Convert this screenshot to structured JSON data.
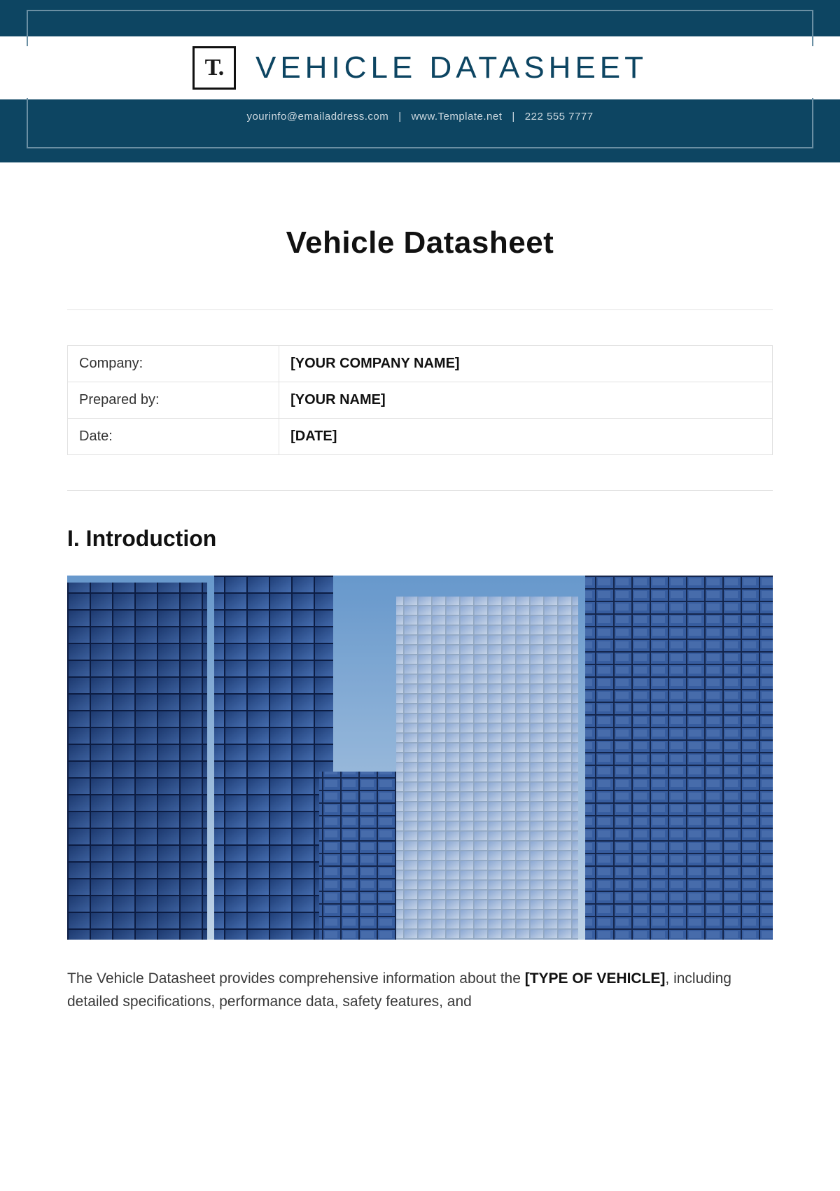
{
  "header": {
    "logo_text": "T.",
    "title": "VEHICLE DATASHEET",
    "contact_email": "yourinfo@emailaddress.com",
    "contact_site": "www.Template.net",
    "contact_phone": "222 555 7777"
  },
  "document": {
    "title": "Vehicle Datasheet"
  },
  "info_table": {
    "rows": [
      {
        "label": "Company:",
        "value": "[YOUR COMPANY NAME]"
      },
      {
        "label": "Prepared by:",
        "value": "[YOUR NAME]"
      },
      {
        "label": "Date:",
        "value": "[DATE]"
      }
    ]
  },
  "sections": {
    "introduction_heading": "I. Introduction",
    "intro_text_pre": "The Vehicle Datasheet provides comprehensive information about the ",
    "intro_bold": "[TYPE OF VEHICLE]",
    "intro_text_post": ", including detailed specifications, performance data, safety features, and"
  }
}
